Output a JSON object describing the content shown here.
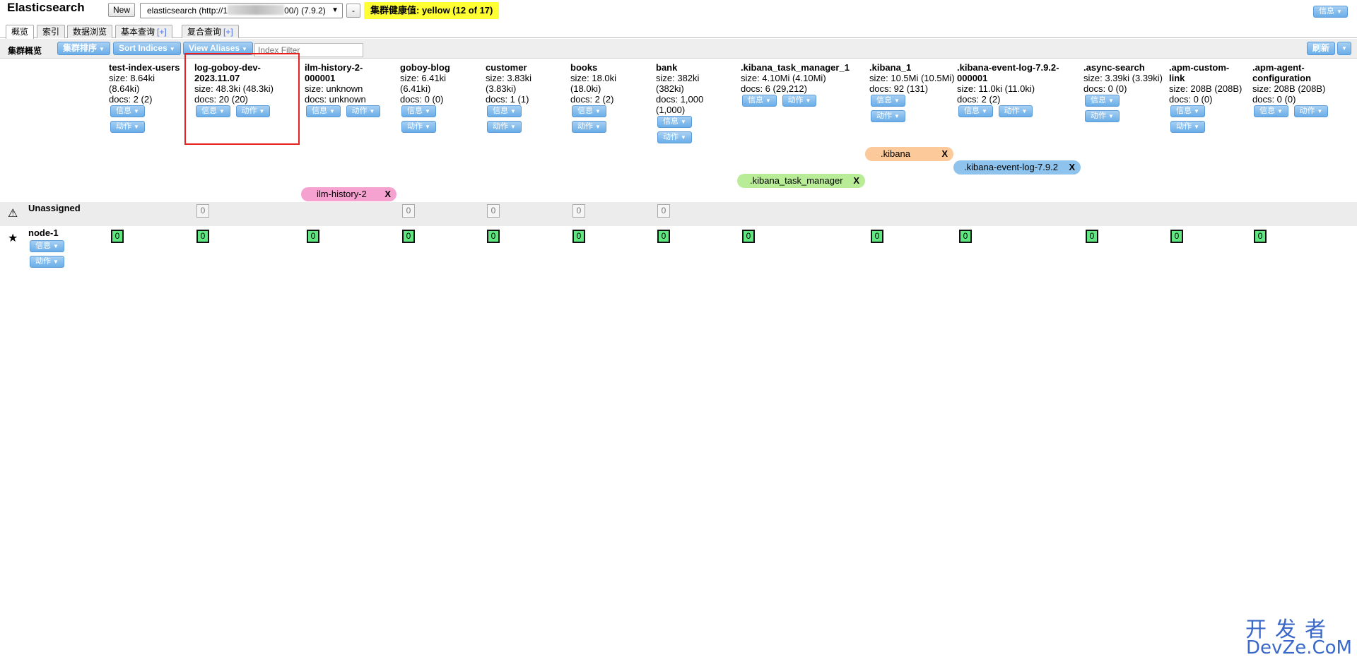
{
  "header": {
    "app_title": "Elasticsearch",
    "new_label": "New",
    "connection_prefix": "elasticsearch (http://1",
    "connection_suffix": "00/) (7.9.2)",
    "minus_label": "-",
    "health_label": "集群健康值: yellow (12 of 17)",
    "health_color": "#ffff33",
    "info_label": "信息"
  },
  "tabs": [
    {
      "label": "概览",
      "plus": ""
    },
    {
      "label": "索引",
      "plus": ""
    },
    {
      "label": "数据浏览",
      "plus": ""
    },
    {
      "label": "基本查询",
      "plus": "[+]"
    },
    {
      "label": "复合查询",
      "plus": "[+]"
    }
  ],
  "toolbar": {
    "title": "集群概览",
    "sort_cluster": "集群排序",
    "sort_indices": "Sort Indices",
    "view_aliases": "View Aliases",
    "filter_placeholder": "Index Filter",
    "refresh": "刷新"
  },
  "buttons": {
    "info": "信息",
    "action": "动作"
  },
  "indices": [
    {
      "name": "test-index-users",
      "size": "size: 8.64ki (8.64ki)",
      "docs": "docs: 2 (2)"
    },
    {
      "name": "log-goboy-dev-2023.11.07",
      "size": "size: 48.3ki (48.3ki)",
      "docs": "docs: 20 (20)"
    },
    {
      "name": "ilm-history-2-000001",
      "size": "size: unknown",
      "docs": "docs: unknown"
    },
    {
      "name": "goboy-blog",
      "size": "size: 6.41ki (6.41ki)",
      "docs": "docs: 0 (0)"
    },
    {
      "name": "customer",
      "size": "size: 3.83ki (3.83ki)",
      "docs": "docs: 1 (1)"
    },
    {
      "name": "books",
      "size": "size: 18.0ki (18.0ki)",
      "docs": "docs: 2 (2)"
    },
    {
      "name": "bank",
      "size": "size: 382ki (382ki)",
      "docs": "docs: 1,000 (1,000)"
    },
    {
      "name": ".kibana_task_manager_1",
      "size": "size: 4.10Mi (4.10Mi)",
      "docs": "docs: 6 (29,212)"
    },
    {
      "name": ".kibana_1",
      "size": "size: 10.5Mi (10.5Mi)",
      "docs": "docs: 92 (131)"
    },
    {
      "name": ".kibana-event-log-7.9.2-000001",
      "size": "size: 11.0ki (11.0ki)",
      "docs": "docs: 2 (2)"
    },
    {
      "name": ".async-search",
      "size": "size: 3.39ki (3.39ki)",
      "docs": "docs: 0 (0)"
    },
    {
      "name": ".apm-custom-link",
      "size": "size: 208B (208B)",
      "docs": "docs: 0 (0)"
    },
    {
      "name": ".apm-agent-configuration",
      "size": "size: 208B (208B)",
      "docs": "docs: 0 (0)"
    }
  ],
  "aliases": [
    {
      "name": ".kibana",
      "x": "X",
      "color": "#fbc99a"
    },
    {
      "name": ".kibana-event-log-7.9.2",
      "x": "X",
      "color": "#8dc3ec"
    },
    {
      "name": ".kibana_task_manager",
      "x": "X",
      "color": "#b9ec97"
    },
    {
      "name": "ilm-history-2",
      "x": "X",
      "color": "#f6a2d0"
    }
  ],
  "rows": {
    "unassigned_label": "Unassigned",
    "node_label": "node-1",
    "shard_value": "0"
  },
  "watermark": {
    "top": "开发者",
    "bottom": "DevZe.CoM"
  }
}
